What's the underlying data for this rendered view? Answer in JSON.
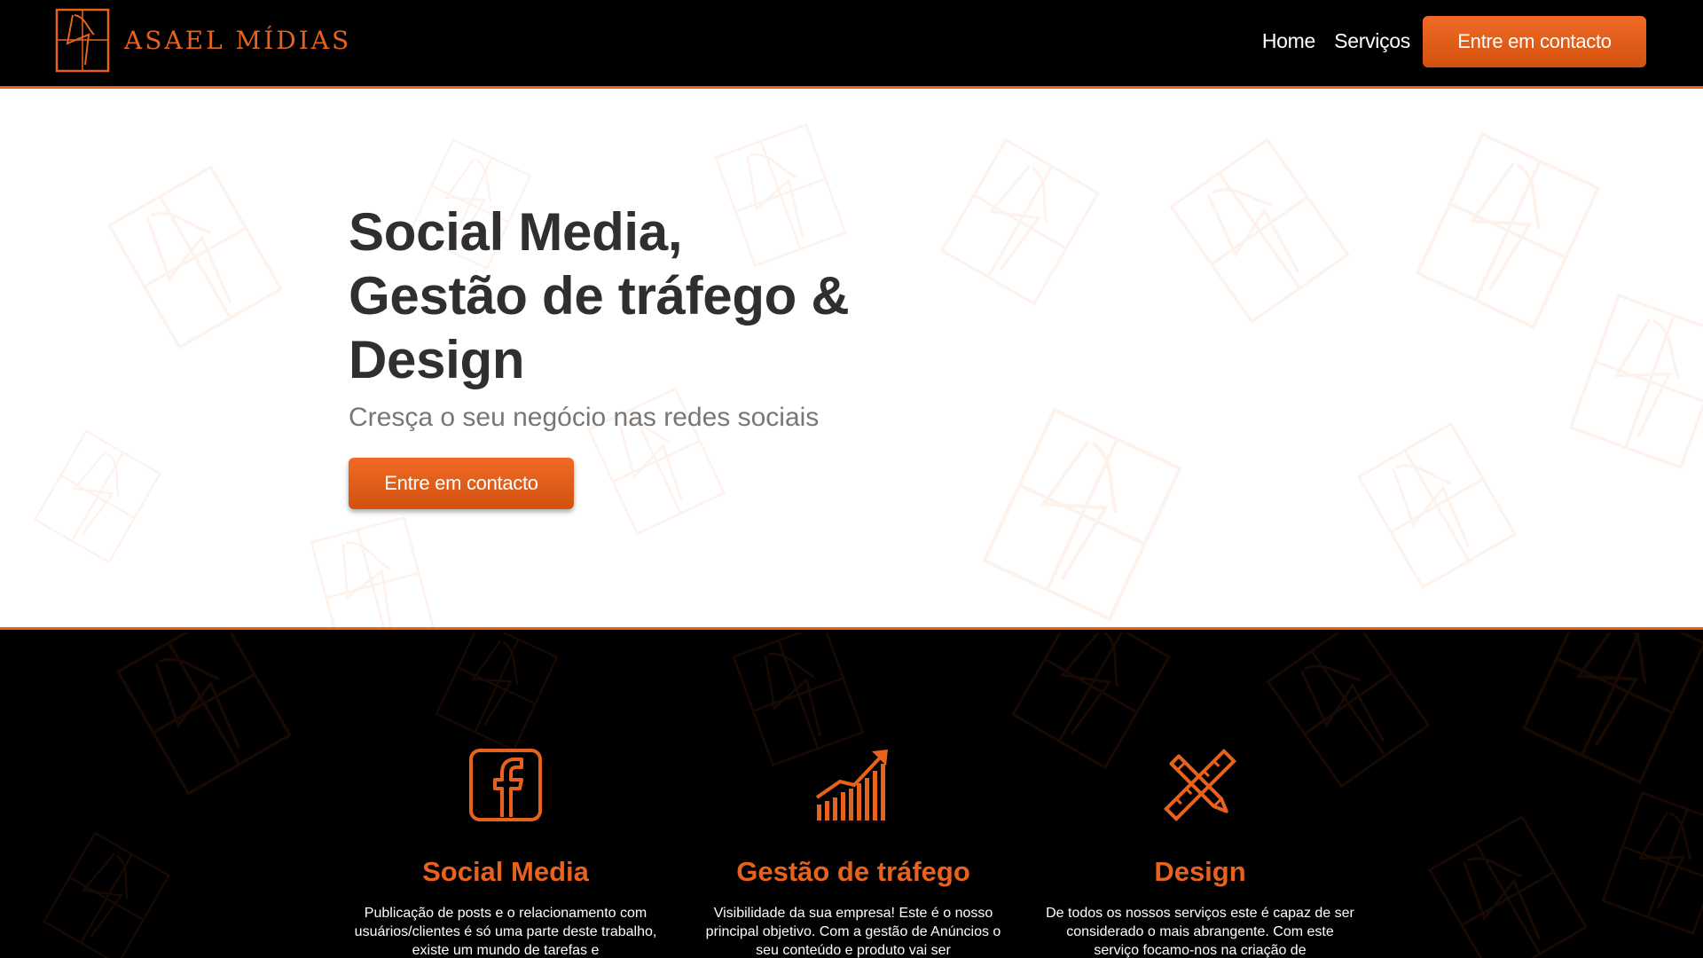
{
  "brand": {
    "name": "ASAEL MÍDIAS",
    "accent": "#e8621d"
  },
  "nav": {
    "links": [
      "Home",
      "Serviços"
    ],
    "cta": "Entre em contacto"
  },
  "hero": {
    "title_lines": [
      "Social Media,",
      "Gestão de tráfego &",
      "Design"
    ],
    "subtitle": "Cresça o seu negócio nas redes sociais",
    "cta": "Entre em contacto"
  },
  "services": [
    {
      "icon": "facebook-icon",
      "title": "Social Media",
      "desc": "Publicação de posts e o relacionamento com usuários/clientes é só uma parte deste trabalho, existe um mundo de tarefas e"
    },
    {
      "icon": "growth-chart-icon",
      "title": "Gestão de tráfego",
      "desc": "Visibilidade da sua empresa! Este é o nosso principal objetivo. Com a gestão de Anúncios o seu conteúdo e produto vai ser"
    },
    {
      "icon": "pencil-ruler-icon",
      "title": "Design",
      "desc": "De todos os nossos serviços este é capaz de ser considerado o mais abrangente. Com este serviço focamo-nos na criação de"
    }
  ]
}
